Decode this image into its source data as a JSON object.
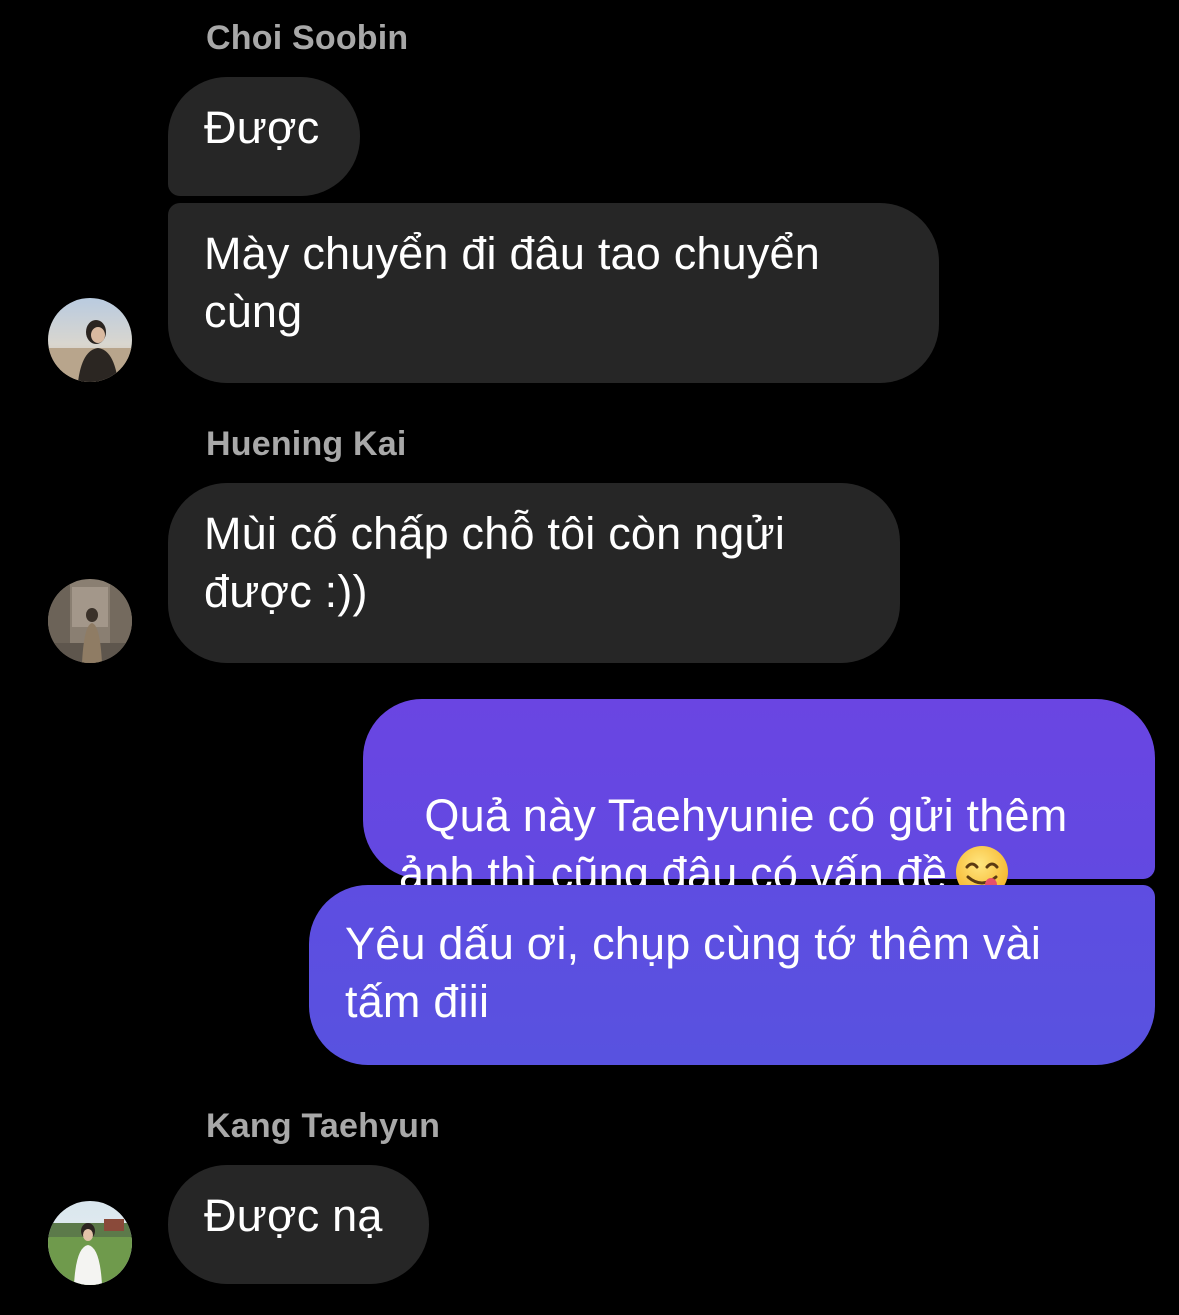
{
  "thread": {
    "groups": [
      {
        "sender": "Choi Soobin",
        "messages": [
          "Được",
          "Mày chuyển đi đâu tao chuyển\ncùng"
        ],
        "avatar": "soobin-avatar"
      },
      {
        "sender": "Huening Kai",
        "messages": [
          "Mùi cố chấp chỗ tôi còn ngửi\nđược :))"
        ],
        "avatar": "hueningkai-avatar"
      },
      {
        "sender": "",
        "outgoing": true,
        "messages": [
          "Quả này Taehyunie có gửi thêm\nảnh thì cũng đâu có vấn đề",
          "Yêu dấu ơi, chụp cùng tớ thêm vài\ntấm điii"
        ],
        "emoji": "yum-face-emoji"
      },
      {
        "sender": "Kang Taehyun",
        "messages": [
          "Được nạ"
        ],
        "avatar": "taehyun-avatar"
      }
    ]
  },
  "colors": {
    "background": "#000000",
    "incoming_bubble": "#262626",
    "outgoing_gradient_top": "#6c44e0",
    "outgoing_gradient_bottom": "#5a52e0",
    "sender_name": "#a8a8a8",
    "text": "#ffffff"
  }
}
